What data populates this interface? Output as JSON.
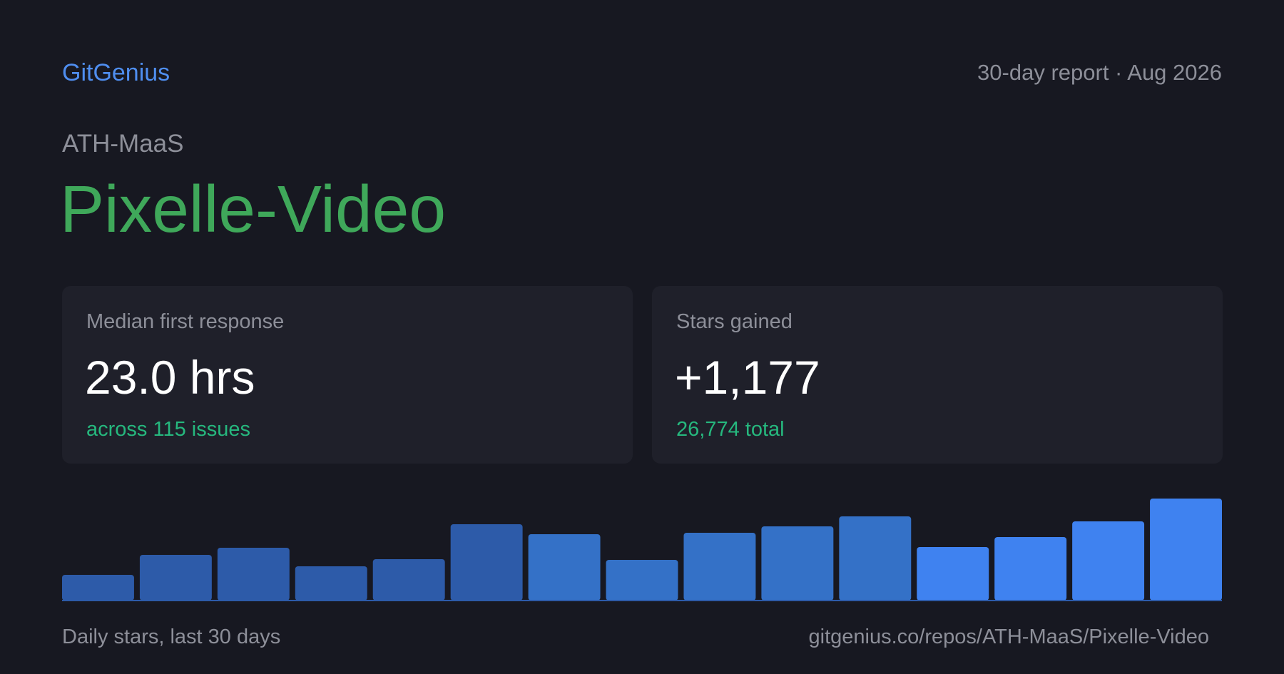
{
  "header": {
    "brand": "GitGenius",
    "report_label": "30-day report · Aug 2026"
  },
  "repo": {
    "owner": "ATH-MaaS",
    "name": "Pixelle-Video"
  },
  "cards": [
    {
      "label": "Median first response",
      "value": "23.0 hrs",
      "sub": "across 115 issues"
    },
    {
      "label": "Stars gained",
      "value": "+1,177",
      "sub": "26,774 total"
    }
  ],
  "chart_data": {
    "type": "bar",
    "values": [
      36,
      64,
      74,
      48,
      58,
      107,
      93,
      57,
      95,
      104,
      118,
      75,
      89,
      111,
      143
    ],
    "colors": [
      "#2d5ba9",
      "#2d5ba9",
      "#2d5ba9",
      "#2d5ba9",
      "#2d5ba9",
      "#2d5ba9",
      "#3471c7",
      "#3471c7",
      "#3471c7",
      "#3471c7",
      "#3471c7",
      "#3f82f0",
      "#3f82f0",
      "#3f82f0",
      "#3f82f0"
    ],
    "ylim": [
      0,
      143
    ],
    "caption": "Daily stars, last 30 days"
  },
  "footer": {
    "url": "gitgenius.co/repos/ATH-MaaS/Pixelle-Video"
  }
}
